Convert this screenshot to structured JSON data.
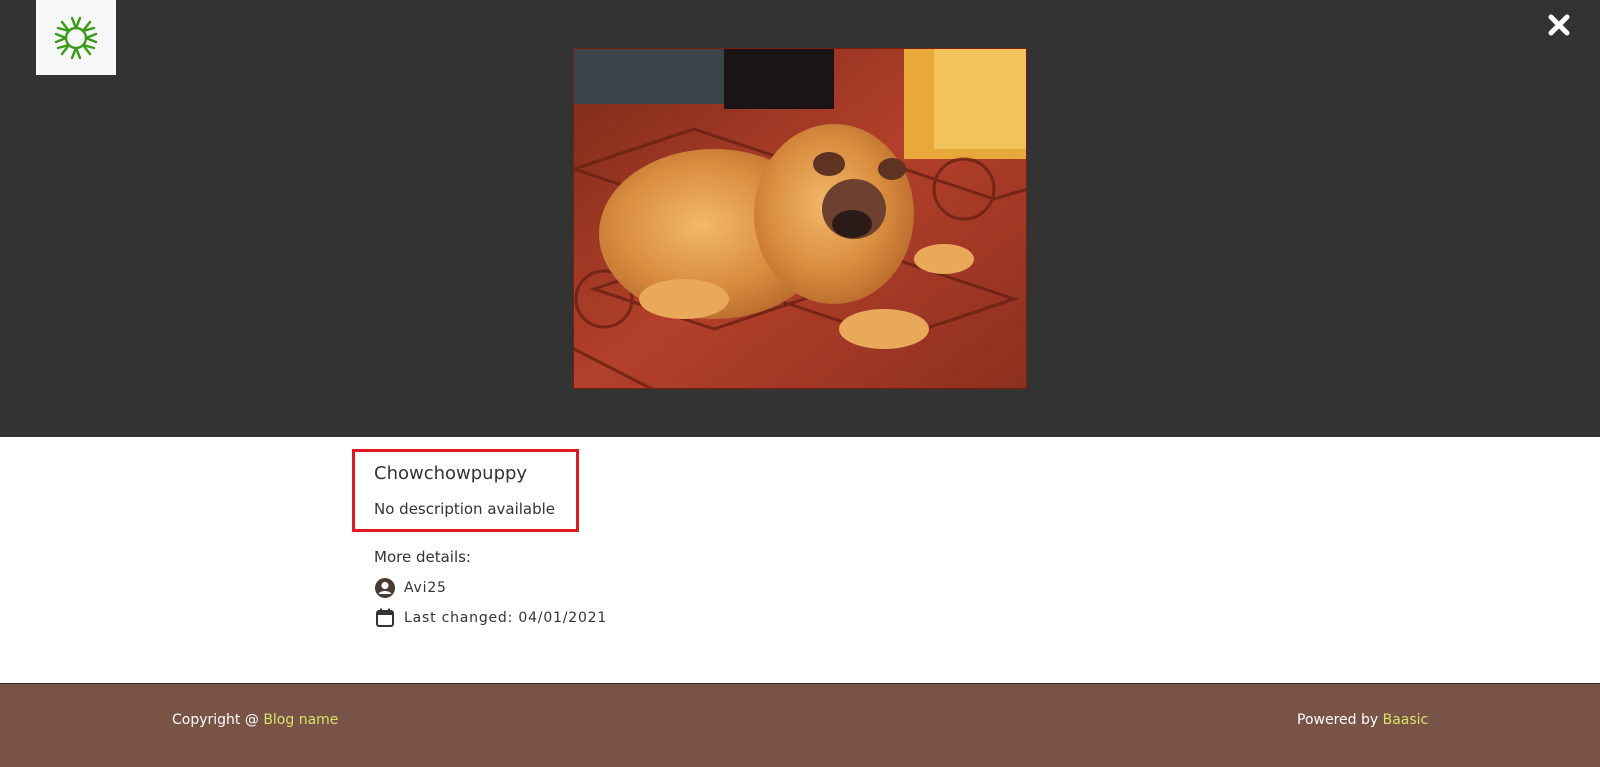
{
  "header": {
    "logo_icon": "sun-logo-icon",
    "close_icon": "close-icon"
  },
  "image": {
    "subject": "chow chow puppy lying on tiled floor"
  },
  "details": {
    "title": "Chowchowpuppy",
    "description": "No description available",
    "more_details_label": "More details:",
    "author": "Avi25",
    "last_changed": "Last changed: 04/01/2021"
  },
  "footer": {
    "copyright_prefix": "Copyright @ ",
    "blog_name": "Blog name",
    "powered_prefix": "Powered by ",
    "powered_link": "Baasic"
  },
  "colors": {
    "viewer_bg": "#333333",
    "footer_bg": "#7a5347",
    "link": "#d6e36b",
    "highlight": "#e0191f",
    "logo_green": "#3a9a1a"
  }
}
